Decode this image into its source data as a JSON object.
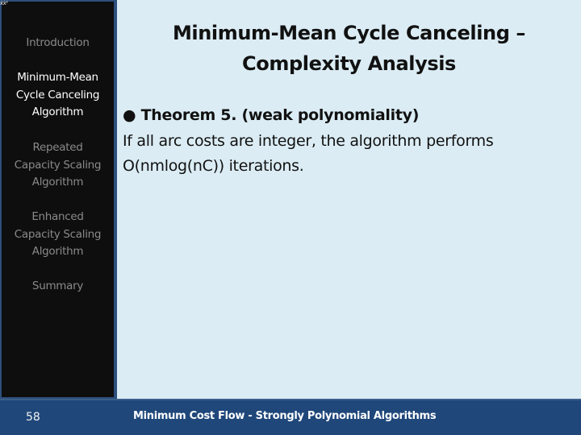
{
  "corner_mark": "ẋẋ²",
  "sidebar": {
    "items": [
      {
        "label": "Introduction",
        "active": false
      },
      {
        "label": "Minimum-Mean Cycle Canceling Algorithm",
        "active": true
      },
      {
        "label": "Repeated Capacity Scaling Algorithm",
        "active": false
      },
      {
        "label": "Enhanced Capacity Scaling Algorithm",
        "active": false
      },
      {
        "label": "Summary",
        "active": false
      }
    ],
    "lines": {
      "item0": [
        "Introduction"
      ],
      "item1": [
        "Minimum-Mean",
        "Cycle Canceling",
        "Algorithm"
      ],
      "item2": [
        "Repeated",
        "Capacity Scaling",
        "Algorithm"
      ],
      "item3": [
        "Enhanced",
        "Capacity Scaling",
        "Algorithm"
      ],
      "item4": [
        "Summary"
      ]
    }
  },
  "slide": {
    "title_line1": "Minimum-Mean Cycle Canceling –",
    "title_line2": "Complexity Analysis",
    "bullet_symbol": "●",
    "theorem_heading": "Theorem 5. (weak polynomiality)",
    "body_line1": "If all arc costs are integer, the algorithm performs",
    "body_line2": "O(nmlog(nC)) iterations."
  },
  "footer": {
    "slide_number": "58",
    "text": "Minimum Cost Flow - Strongly Polynomial Algorithms"
  },
  "colors": {
    "background": "#dbecf4",
    "sidebar_bg": "#0e0e0e",
    "frame_blue": "#2d4f7c",
    "footer_blue": "#1f477a",
    "active_nav": "#ffffff",
    "inactive_nav": "#8a8a8a"
  }
}
